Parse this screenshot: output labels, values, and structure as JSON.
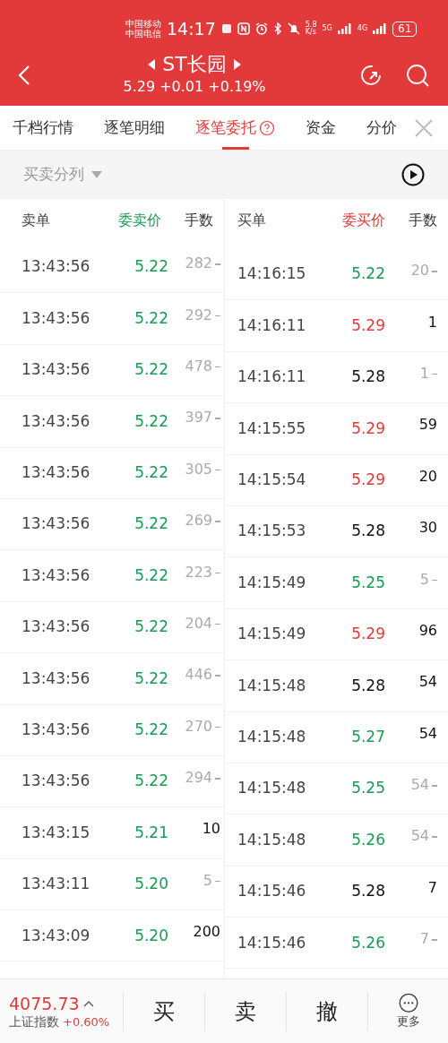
{
  "status_bar": {
    "carriers": [
      "中国移动",
      "中国电信"
    ],
    "time": "14:17",
    "speed": [
      "5.8",
      "K/s"
    ],
    "networks": [
      "5G",
      "4G"
    ],
    "battery": "61"
  },
  "header": {
    "title": "ST长园",
    "quote": "5.29 +0.01 +0.19%"
  },
  "tabs": [
    {
      "label": "千档行情",
      "selected": false
    },
    {
      "label": "逐笔明细",
      "selected": false
    },
    {
      "label": "逐笔委托",
      "selected": true,
      "help": true
    },
    {
      "label": "资金",
      "selected": false
    },
    {
      "label": "分价",
      "selected": false
    }
  ],
  "filter": {
    "label": "买卖分列"
  },
  "sell": {
    "columns": [
      "卖单",
      "委卖价",
      "手数"
    ],
    "rows": [
      {
        "time": "13:43:56",
        "price": "5.22",
        "color": "#1a9a55",
        "qty": "282",
        "withdrawn": true
      },
      {
        "time": "13:43:56",
        "price": "5.22",
        "color": "#1a9a55",
        "qty": "292",
        "withdrawn": true
      },
      {
        "time": "13:43:56",
        "price": "5.22",
        "color": "#1a9a55",
        "qty": "478",
        "withdrawn": true
      },
      {
        "time": "13:43:56",
        "price": "5.22",
        "color": "#1a9a55",
        "qty": "397",
        "withdrawn": true
      },
      {
        "time": "13:43:56",
        "price": "5.22",
        "color": "#1a9a55",
        "qty": "305",
        "withdrawn": true
      },
      {
        "time": "13:43:56",
        "price": "5.22",
        "color": "#1a9a55",
        "qty": "269",
        "withdrawn": true
      },
      {
        "time": "13:43:56",
        "price": "5.22",
        "color": "#1a9a55",
        "qty": "223",
        "withdrawn": true
      },
      {
        "time": "13:43:56",
        "price": "5.22",
        "color": "#1a9a55",
        "qty": "204",
        "withdrawn": true
      },
      {
        "time": "13:43:56",
        "price": "5.22",
        "color": "#1a9a55",
        "qty": "446",
        "withdrawn": true
      },
      {
        "time": "13:43:56",
        "price": "5.22",
        "color": "#1a9a55",
        "qty": "270",
        "withdrawn": true
      },
      {
        "time": "13:43:56",
        "price": "5.22",
        "color": "#1a9a55",
        "qty": "294",
        "withdrawn": true
      },
      {
        "time": "13:43:15",
        "price": "5.21",
        "color": "#1a9a55",
        "qty": "10",
        "withdrawn": false
      },
      {
        "time": "13:43:11",
        "price": "5.20",
        "color": "#1a9a55",
        "qty": "5",
        "withdrawn": true
      },
      {
        "time": "13:43:09",
        "price": "5.20",
        "color": "#1a9a55",
        "qty": "200",
        "withdrawn": false
      }
    ]
  },
  "buy": {
    "columns": [
      "买单",
      "委买价",
      "手数"
    ],
    "rows": [
      {
        "time": "14:16:15",
        "price": "5.22",
        "color": "#1a9a55",
        "qty": "20",
        "withdrawn": true
      },
      {
        "time": "14:16:11",
        "price": "5.29",
        "color": "#e23a3a",
        "qty": "1",
        "withdrawn": false
      },
      {
        "time": "14:16:11",
        "price": "5.28",
        "color": "#111111",
        "qty": "1",
        "withdrawn": true
      },
      {
        "time": "14:15:55",
        "price": "5.29",
        "color": "#e23a3a",
        "qty": "59",
        "withdrawn": false
      },
      {
        "time": "14:15:54",
        "price": "5.29",
        "color": "#e23a3a",
        "qty": "20",
        "withdrawn": false
      },
      {
        "time": "14:15:53",
        "price": "5.28",
        "color": "#111111",
        "qty": "30",
        "withdrawn": false
      },
      {
        "time": "14:15:49",
        "price": "5.25",
        "color": "#1a9a55",
        "qty": "5",
        "withdrawn": true
      },
      {
        "time": "14:15:49",
        "price": "5.29",
        "color": "#e23a3a",
        "qty": "96",
        "withdrawn": false
      },
      {
        "time": "14:15:48",
        "price": "5.28",
        "color": "#111111",
        "qty": "54",
        "withdrawn": false
      },
      {
        "time": "14:15:48",
        "price": "5.27",
        "color": "#1a9a55",
        "qty": "54",
        "withdrawn": false
      },
      {
        "time": "14:15:48",
        "price": "5.25",
        "color": "#1a9a55",
        "qty": "54",
        "withdrawn": true
      },
      {
        "time": "14:15:48",
        "price": "5.26",
        "color": "#1a9a55",
        "qty": "54",
        "withdrawn": true
      },
      {
        "time": "14:15:46",
        "price": "5.28",
        "color": "#111111",
        "qty": "7",
        "withdrawn": false
      },
      {
        "time": "14:15:46",
        "price": "5.26",
        "color": "#1a9a55",
        "qty": "7",
        "withdrawn": true
      }
    ]
  },
  "bottom_bar": {
    "index_value": "4075.73",
    "index_name": "上证指数",
    "index_change": "+0.60%",
    "actions": [
      "买",
      "卖",
      "撤"
    ],
    "more": "更多"
  }
}
